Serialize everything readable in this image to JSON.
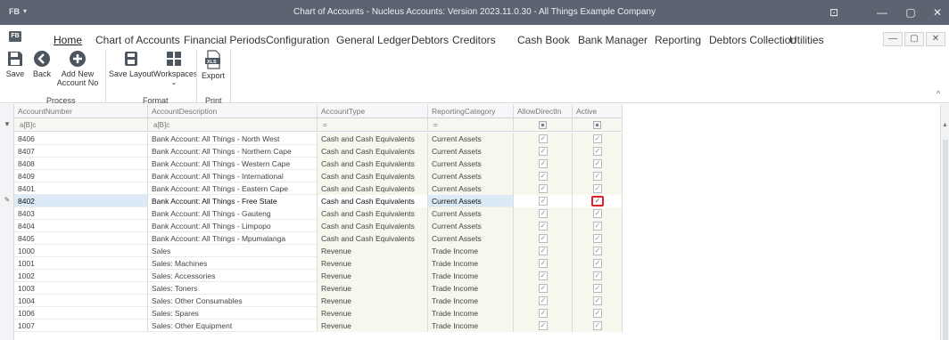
{
  "window": {
    "app_glyph": "FB",
    "caret": "▾",
    "title": "Chart of Accounts - Nucleus Accounts: Version 2023.11.0.30 - All Things Example Company",
    "controls": {
      "restore_glyph": "⊡",
      "minimize_glyph": "—",
      "maximize_glyph": "▢",
      "close_glyph": "✕"
    }
  },
  "menu": {
    "logo": "FB",
    "items": [
      "Home",
      "Chart of Accounts",
      "Financial Periods",
      "Configuration",
      "General Ledger",
      "Debtors",
      "Creditors",
      "Cash Book",
      "Bank Manager",
      "Reporting",
      "Debtors Collection",
      "Utilities"
    ],
    "active": "Home",
    "doc_controls": [
      "—",
      "▢",
      "✕"
    ]
  },
  "ribbon": {
    "groups": {
      "process": {
        "label": "Process",
        "buttons": [
          "Save",
          "Back",
          "Add New Account No"
        ]
      },
      "format": {
        "label": "Format",
        "buttons": [
          "Save Layout",
          "Workspaces"
        ]
      },
      "print": {
        "label": "Print",
        "buttons": [
          "Export"
        ]
      }
    },
    "workspaces_caret": "⌄",
    "collapse_caret": "^",
    "icons": {
      "save": "save-icon",
      "back": "back-arrow-icon",
      "add": "plus-circle-icon",
      "save_layout": "layout-save-icon",
      "workspaces": "grid-tiles-icon",
      "export": "xls-export-icon"
    }
  },
  "grid": {
    "columns": [
      "AccountNumber",
      "AccountDescription",
      "AccountType",
      "ReportingCategory",
      "AllowDirectIn",
      "Active"
    ],
    "filter_glyphs": {
      "text": "a[B]c",
      "equals": "="
    },
    "filter_icon": "▼",
    "edit_icon": "✎",
    "rows": [
      {
        "number": "8406",
        "description": "Bank Account: All Things - North West",
        "type": "Cash and Cash Equivalents",
        "category": "Current Assets",
        "allow": "✓",
        "active": "✓"
      },
      {
        "number": "8407",
        "description": "Bank Account: All Things - Northern Cape",
        "type": "Cash and Cash Equivalents",
        "category": "Current Assets",
        "allow": "✓",
        "active": "✓"
      },
      {
        "number": "8408",
        "description": "Bank Account: All Things - Western Cape",
        "type": "Cash and Cash Equivalents",
        "category": "Current Assets",
        "allow": "✓",
        "active": "✓"
      },
      {
        "number": "8409",
        "description": "Bank Account: All Things - International",
        "type": "Cash and Cash Equivalents",
        "category": "Current Assets",
        "allow": "✓",
        "active": "✓"
      },
      {
        "number": "8401",
        "description": "Bank Account: All Things - Eastern Cape",
        "type": "Cash and Cash Equivalents",
        "category": "Current Assets",
        "allow": "✓",
        "active": "✓"
      },
      {
        "number": "8402",
        "description": "Bank Account: All Things - Free State",
        "type": "Cash and Cash Equivalents",
        "category": "Current Assets",
        "allow": "✓",
        "active": "✓"
      },
      {
        "number": "8403",
        "description": "Bank Account: All Things - Gauteng",
        "type": "Cash and Cash Equivalents",
        "category": "Current Assets",
        "allow": "✓",
        "active": "✓"
      },
      {
        "number": "8404",
        "description": "Bank Account: All Things - Limpopo",
        "type": "Cash and Cash Equivalents",
        "category": "Current Assets",
        "allow": "✓",
        "active": "✓"
      },
      {
        "number": "8405",
        "description": "Bank Account: All Things - Mpumalanga",
        "type": "Cash and Cash Equivalents",
        "category": "Current Assets",
        "allow": "✓",
        "active": "✓"
      },
      {
        "number": "1000",
        "description": "Sales",
        "type": "Revenue",
        "category": "Trade Income",
        "allow": "✓",
        "active": "✓"
      },
      {
        "number": "1001",
        "description": "Sales: Machines",
        "type": "Revenue",
        "category": "Trade Income",
        "allow": "✓",
        "active": "✓"
      },
      {
        "number": "1002",
        "description": "Sales: Accessories",
        "type": "Revenue",
        "category": "Trade Income",
        "allow": "✓",
        "active": "✓"
      },
      {
        "number": "1003",
        "description": "Sales: Toners",
        "type": "Revenue",
        "category": "Trade Income",
        "allow": "✓",
        "active": "✓"
      },
      {
        "number": "1004",
        "description": "Sales: Other Consumables",
        "type": "Revenue",
        "category": "Trade Income",
        "allow": "✓",
        "active": "✓"
      },
      {
        "number": "1006",
        "description": "Sales: Spares",
        "type": "Revenue",
        "category": "Trade Income",
        "allow": "✓",
        "active": "✓"
      },
      {
        "number": "1007",
        "description": "Sales: Other Equipment",
        "type": "Revenue",
        "category": "Trade Income",
        "allow": "✓",
        "active": "✓"
      }
    ],
    "selected_row": "8402"
  },
  "colors": {
    "titlebar": "#5b6470",
    "selection": "#dce9f6",
    "focus_ring": "#e0202a"
  }
}
